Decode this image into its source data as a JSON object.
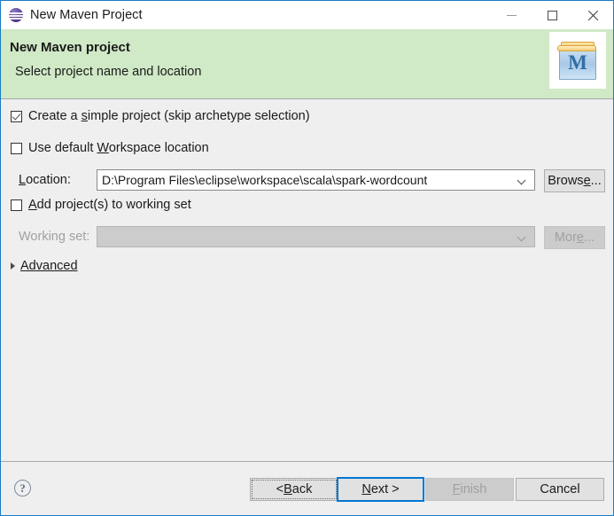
{
  "window": {
    "title": "New Maven Project",
    "app_icon": "eclipse-sphere-icon",
    "minimize_label": "Minimize",
    "maximize_label": "Maximize",
    "close_label": "Close"
  },
  "banner": {
    "title": "New Maven project",
    "subtitle": "Select project name and location",
    "icon": "maven-project-icon",
    "icon_letter": "M",
    "background_color": "#d0e9c6"
  },
  "form": {
    "simple_project": {
      "label_before": "Create a ",
      "mnemonic": "s",
      "label_after": "imple project (skip archetype selection)",
      "checked": true
    },
    "default_workspace": {
      "label_before": "Use default ",
      "mnemonic": "W",
      "label_after": "orkspace location",
      "checked": false
    },
    "location": {
      "label_mnemonic": "L",
      "label_rest": "ocation:",
      "value": "D:\\Program Files\\eclipse\\workspace\\scala\\spark-wordcount",
      "browse_before": "Brows",
      "browse_mnemonic": "e",
      "browse_after": "..."
    },
    "working_set_checkbox": {
      "mnemonic": "A",
      "label_after": "dd project(s) to working set",
      "checked": false
    },
    "working_set": {
      "label": "Working set:",
      "value": "",
      "enabled": false,
      "more_before": "Mor",
      "more_mnemonic": "e",
      "more_after": "..."
    },
    "advanced": {
      "label_before": "Ad",
      "mnemonic": "v",
      "label_after": "anced",
      "expanded": false
    }
  },
  "footer": {
    "help_glyph": "?",
    "buttons": {
      "back": {
        "before": "< ",
        "mnemonic": "B",
        "after": "ack",
        "enabled": true,
        "focused": true
      },
      "next": {
        "before": "",
        "mnemonic": "N",
        "after": "ext >",
        "enabled": true,
        "default": true
      },
      "finish": {
        "before": "",
        "mnemonic": "F",
        "after": "inish",
        "enabled": false
      },
      "cancel": {
        "before": "Cancel",
        "mnemonic": "",
        "after": "",
        "enabled": true
      }
    }
  }
}
